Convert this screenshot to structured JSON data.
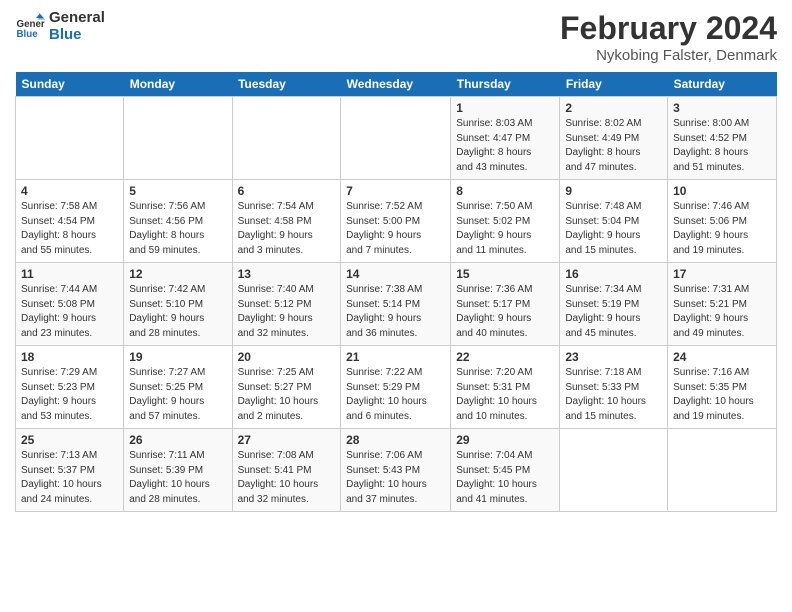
{
  "header": {
    "logo_line1": "General",
    "logo_line2": "Blue",
    "month_title": "February 2024",
    "location": "Nykobing Falster, Denmark"
  },
  "days_of_week": [
    "Sunday",
    "Monday",
    "Tuesday",
    "Wednesday",
    "Thursday",
    "Friday",
    "Saturday"
  ],
  "weeks": [
    [
      {
        "day": "",
        "info": ""
      },
      {
        "day": "",
        "info": ""
      },
      {
        "day": "",
        "info": ""
      },
      {
        "day": "",
        "info": ""
      },
      {
        "day": "1",
        "info": "Sunrise: 8:03 AM\nSunset: 4:47 PM\nDaylight: 8 hours\nand 43 minutes."
      },
      {
        "day": "2",
        "info": "Sunrise: 8:02 AM\nSunset: 4:49 PM\nDaylight: 8 hours\nand 47 minutes."
      },
      {
        "day": "3",
        "info": "Sunrise: 8:00 AM\nSunset: 4:52 PM\nDaylight: 8 hours\nand 51 minutes."
      }
    ],
    [
      {
        "day": "4",
        "info": "Sunrise: 7:58 AM\nSunset: 4:54 PM\nDaylight: 8 hours\nand 55 minutes."
      },
      {
        "day": "5",
        "info": "Sunrise: 7:56 AM\nSunset: 4:56 PM\nDaylight: 8 hours\nand 59 minutes."
      },
      {
        "day": "6",
        "info": "Sunrise: 7:54 AM\nSunset: 4:58 PM\nDaylight: 9 hours\nand 3 minutes."
      },
      {
        "day": "7",
        "info": "Sunrise: 7:52 AM\nSunset: 5:00 PM\nDaylight: 9 hours\nand 7 minutes."
      },
      {
        "day": "8",
        "info": "Sunrise: 7:50 AM\nSunset: 5:02 PM\nDaylight: 9 hours\nand 11 minutes."
      },
      {
        "day": "9",
        "info": "Sunrise: 7:48 AM\nSunset: 5:04 PM\nDaylight: 9 hours\nand 15 minutes."
      },
      {
        "day": "10",
        "info": "Sunrise: 7:46 AM\nSunset: 5:06 PM\nDaylight: 9 hours\nand 19 minutes."
      }
    ],
    [
      {
        "day": "11",
        "info": "Sunrise: 7:44 AM\nSunset: 5:08 PM\nDaylight: 9 hours\nand 23 minutes."
      },
      {
        "day": "12",
        "info": "Sunrise: 7:42 AM\nSunset: 5:10 PM\nDaylight: 9 hours\nand 28 minutes."
      },
      {
        "day": "13",
        "info": "Sunrise: 7:40 AM\nSunset: 5:12 PM\nDaylight: 9 hours\nand 32 minutes."
      },
      {
        "day": "14",
        "info": "Sunrise: 7:38 AM\nSunset: 5:14 PM\nDaylight: 9 hours\nand 36 minutes."
      },
      {
        "day": "15",
        "info": "Sunrise: 7:36 AM\nSunset: 5:17 PM\nDaylight: 9 hours\nand 40 minutes."
      },
      {
        "day": "16",
        "info": "Sunrise: 7:34 AM\nSunset: 5:19 PM\nDaylight: 9 hours\nand 45 minutes."
      },
      {
        "day": "17",
        "info": "Sunrise: 7:31 AM\nSunset: 5:21 PM\nDaylight: 9 hours\nand 49 minutes."
      }
    ],
    [
      {
        "day": "18",
        "info": "Sunrise: 7:29 AM\nSunset: 5:23 PM\nDaylight: 9 hours\nand 53 minutes."
      },
      {
        "day": "19",
        "info": "Sunrise: 7:27 AM\nSunset: 5:25 PM\nDaylight: 9 hours\nand 57 minutes."
      },
      {
        "day": "20",
        "info": "Sunrise: 7:25 AM\nSunset: 5:27 PM\nDaylight: 10 hours\nand 2 minutes."
      },
      {
        "day": "21",
        "info": "Sunrise: 7:22 AM\nSunset: 5:29 PM\nDaylight: 10 hours\nand 6 minutes."
      },
      {
        "day": "22",
        "info": "Sunrise: 7:20 AM\nSunset: 5:31 PM\nDaylight: 10 hours\nand 10 minutes."
      },
      {
        "day": "23",
        "info": "Sunrise: 7:18 AM\nSunset: 5:33 PM\nDaylight: 10 hours\nand 15 minutes."
      },
      {
        "day": "24",
        "info": "Sunrise: 7:16 AM\nSunset: 5:35 PM\nDaylight: 10 hours\nand 19 minutes."
      }
    ],
    [
      {
        "day": "25",
        "info": "Sunrise: 7:13 AM\nSunset: 5:37 PM\nDaylight: 10 hours\nand 24 minutes."
      },
      {
        "day": "26",
        "info": "Sunrise: 7:11 AM\nSunset: 5:39 PM\nDaylight: 10 hours\nand 28 minutes."
      },
      {
        "day": "27",
        "info": "Sunrise: 7:08 AM\nSunset: 5:41 PM\nDaylight: 10 hours\nand 32 minutes."
      },
      {
        "day": "28",
        "info": "Sunrise: 7:06 AM\nSunset: 5:43 PM\nDaylight: 10 hours\nand 37 minutes."
      },
      {
        "day": "29",
        "info": "Sunrise: 7:04 AM\nSunset: 5:45 PM\nDaylight: 10 hours\nand 41 minutes."
      },
      {
        "day": "",
        "info": ""
      },
      {
        "day": "",
        "info": ""
      }
    ]
  ]
}
